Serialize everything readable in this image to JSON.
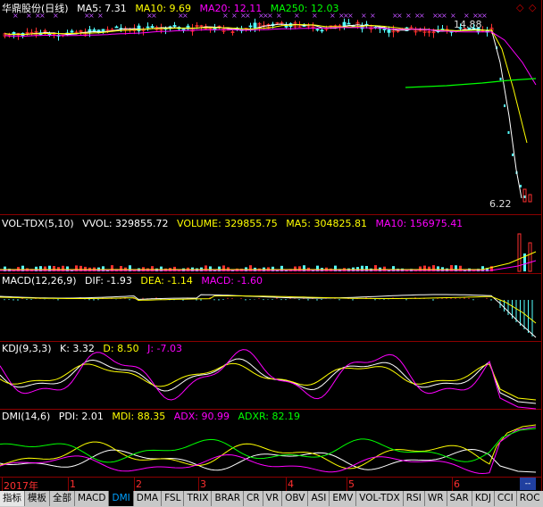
{
  "main": {
    "stock": "华鼎股份(日线)",
    "ma5": "MA5: 7.31",
    "ma10": "MA10: 9.69",
    "ma20": "MA20: 12.11",
    "ma250": "MA250: 12.03",
    "high_label": "14.88",
    "low_label": "6.22",
    "colors": {
      "ma5": "#ffffff",
      "ma10": "#ffff00",
      "ma20": "#ff00ff",
      "ma250": "#00ff00",
      "up": "#ff3030",
      "down": "#54ffff"
    }
  },
  "vol": {
    "name": "VOL-TDX(5,10)",
    "vvol": "VVOL: 329855.72",
    "volume": "VOLUME: 329855.75",
    "ma5": "MA5: 304825.81",
    "ma10": "MA10: 156975.41"
  },
  "macd": {
    "name": "MACD(12,26,9)",
    "dif": "DIF: -1.93",
    "dea": "DEA: -1.14",
    "macd": "MACD: -1.60"
  },
  "kdj": {
    "name": "KDJ(9,3,3)",
    "k": "K: 3.32",
    "d": "D: 8.50",
    "j": "J: -7.03"
  },
  "dmi": {
    "name": "DMI(14,6)",
    "pdi": "PDI: 2.01",
    "mdi": "MDI: 88.35",
    "adx": "ADX: 90.99",
    "adxr": "ADXR: 82.19"
  },
  "timeaxis": {
    "labels": [
      "2017年",
      "1",
      "2",
      "3",
      "4",
      "5",
      "6"
    ],
    "scroll": "--"
  },
  "tabs": [
    "指标",
    "模板",
    "全部",
    "MACD",
    "DMI",
    "DMA",
    "FSL",
    "TRIX",
    "BRAR",
    "CR",
    "VR",
    "OBV",
    "ASI",
    "EMV",
    "VOL-TDX",
    "RSI",
    "WR",
    "SAR",
    "KDJ",
    "CCI",
    "ROC"
  ],
  "selected_tab": "DMI"
}
